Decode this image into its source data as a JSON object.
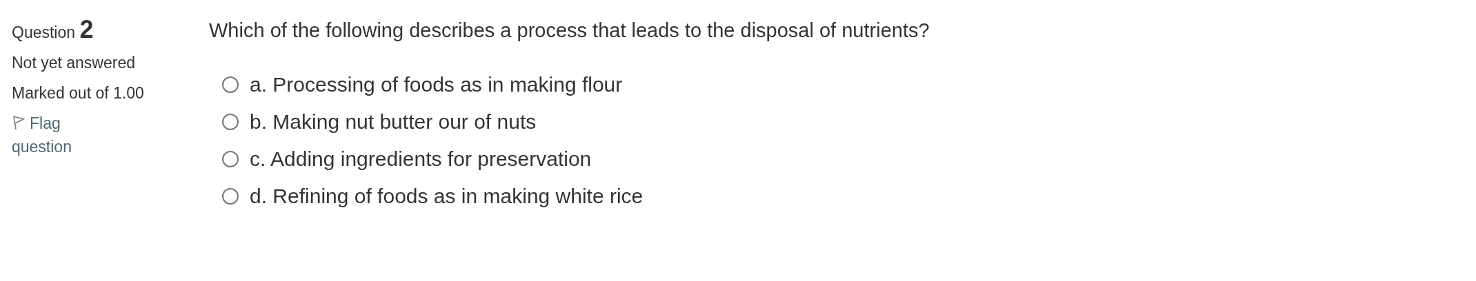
{
  "info": {
    "label": "Question",
    "number": "2",
    "state": "Not yet answered",
    "grade": "Marked out of 1.00",
    "flag": {
      "label": "Flag question",
      "flagged": false
    }
  },
  "question": {
    "text": "Which of the following describes a process that leads to the disposal of nutrients?",
    "options": [
      {
        "label": "a. Processing of foods as in making flour",
        "selected": false
      },
      {
        "label": "b. Making nut butter our of nuts",
        "selected": false
      },
      {
        "label": "c. Adding ingredients for preservation",
        "selected": false
      },
      {
        "label": "d. Refining of foods as in making white rice",
        "selected": false
      }
    ]
  }
}
